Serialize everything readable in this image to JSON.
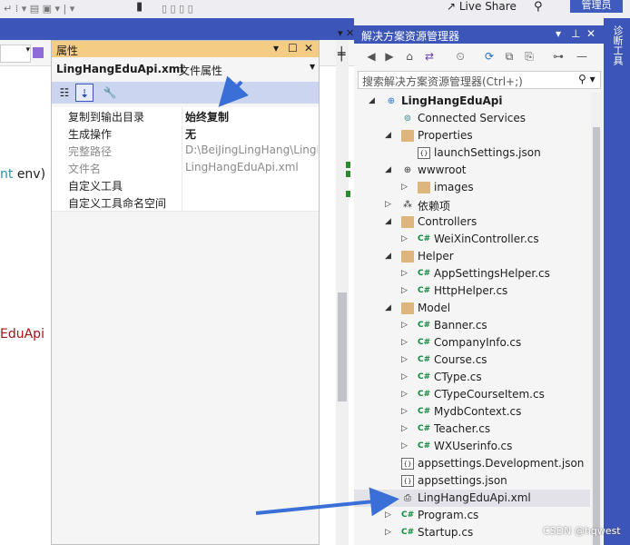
{
  "toolbar": {
    "live_share": "Live Share",
    "sign_in": "管理员"
  },
  "diagnostics_tab": "诊断工具",
  "editor": {
    "code_line_1_text": "nt ",
    "code_line_1_kw": "env)",
    "code_line_2": "EduApi"
  },
  "properties": {
    "title": "属性",
    "file_name": "LingHangEduApi.xml",
    "file_type": "文件属性",
    "rows": [
      {
        "name": "复制到输出目录",
        "value": "始终复制",
        "bold": true
      },
      {
        "name": "生成操作",
        "value": "无",
        "bold": true
      },
      {
        "name": "完整路径",
        "value": "D:\\BeiJingLingHang\\LingH",
        "gray": true
      },
      {
        "name": "文件名",
        "value": "LingHangEduApi.xml",
        "gray": true
      },
      {
        "name": "自定义工具",
        "value": ""
      },
      {
        "name": "自定义工具命名空间",
        "value": ""
      }
    ]
  },
  "solution_explorer": {
    "title": "解决方案资源管理器",
    "search_placeholder": "搜索解决方案资源管理器(Ctrl+;)",
    "items": [
      {
        "label": "LingHangEduApi",
        "icon": "project-icon",
        "level": 0,
        "arrow": "down",
        "bold": true
      },
      {
        "label": "Connected Services",
        "icon": "connected-services-icon",
        "level": 1,
        "arrow": ""
      },
      {
        "label": "Properties",
        "icon": "folder-icon",
        "level": 1,
        "arrow": "down"
      },
      {
        "label": "launchSettings.json",
        "icon": "json-file-icon",
        "level": 2,
        "arrow": ""
      },
      {
        "label": "wwwroot",
        "icon": "globe-icon",
        "level": 1,
        "arrow": "down"
      },
      {
        "label": "images",
        "icon": "folder-icon",
        "level": 2,
        "arrow": "right"
      },
      {
        "label": "依赖项",
        "icon": "dependencies-icon",
        "level": 1,
        "arrow": "right"
      },
      {
        "label": "Controllers",
        "icon": "folder-icon",
        "level": 1,
        "arrow": "down"
      },
      {
        "label": "WeiXinController.cs",
        "icon": "csharp-file-icon",
        "level": 2,
        "arrow": "right"
      },
      {
        "label": "Helper",
        "icon": "folder-icon",
        "level": 1,
        "arrow": "down"
      },
      {
        "label": "AppSettingsHelper.cs",
        "icon": "csharp-file-icon",
        "level": 2,
        "arrow": "right"
      },
      {
        "label": "HttpHelper.cs",
        "icon": "csharp-file-icon",
        "level": 2,
        "arrow": "right"
      },
      {
        "label": "Model",
        "icon": "folder-icon",
        "level": 1,
        "arrow": "down"
      },
      {
        "label": "Banner.cs",
        "icon": "csharp-file-icon",
        "level": 2,
        "arrow": "right"
      },
      {
        "label": "CompanyInfo.cs",
        "icon": "csharp-file-icon",
        "level": 2,
        "arrow": "right"
      },
      {
        "label": "Course.cs",
        "icon": "csharp-file-icon",
        "level": 2,
        "arrow": "right"
      },
      {
        "label": "CType.cs",
        "icon": "csharp-file-icon",
        "level": 2,
        "arrow": "right"
      },
      {
        "label": "CTypeCourseItem.cs",
        "icon": "csharp-file-icon",
        "level": 2,
        "arrow": "right"
      },
      {
        "label": "MydbContext.cs",
        "icon": "csharp-file-icon",
        "level": 2,
        "arrow": "right"
      },
      {
        "label": "Teacher.cs",
        "icon": "csharp-file-icon",
        "level": 2,
        "arrow": "right"
      },
      {
        "label": "WXUserinfo.cs",
        "icon": "csharp-file-icon",
        "level": 2,
        "arrow": "right"
      },
      {
        "label": "appsettings.Development.json",
        "icon": "json-file-icon",
        "level": 1,
        "arrow": ""
      },
      {
        "label": "appsettings.json",
        "icon": "json-file-icon",
        "level": 1,
        "arrow": ""
      },
      {
        "label": "LingHangEduApi.xml",
        "icon": "xml-file-icon",
        "level": 1,
        "arrow": "",
        "selected": true
      },
      {
        "label": "Program.cs",
        "icon": "csharp-file-icon",
        "level": 1,
        "arrow": "right"
      },
      {
        "label": "Startup.cs",
        "icon": "csharp-file-icon",
        "level": 1,
        "arrow": "right"
      }
    ]
  },
  "watermark": "CSDN @hqwest",
  "colors": {
    "accent": "#3c55b8",
    "panel_title": "#f5cc84",
    "annotation_arrow": "#3a6fd8",
    "csharp": "#0f8a3c"
  }
}
